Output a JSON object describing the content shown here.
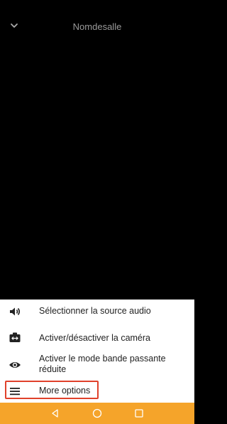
{
  "header": {
    "title": "Nomdesalle"
  },
  "menu": {
    "items": [
      {
        "label": "Sélectionner la source audio",
        "icon": "speaker-icon"
      },
      {
        "label": "Activer/désactiver la caméra",
        "icon": "camera-switch-icon"
      },
      {
        "label": "Activer le mode bande passante réduite",
        "icon": "eye-icon"
      },
      {
        "label": "More options",
        "icon": "menu-icon"
      }
    ]
  },
  "colors": {
    "navbar": "#f5a42a",
    "highlight": "#e0412b",
    "sheet": "#ffffff",
    "background": "#000000"
  }
}
